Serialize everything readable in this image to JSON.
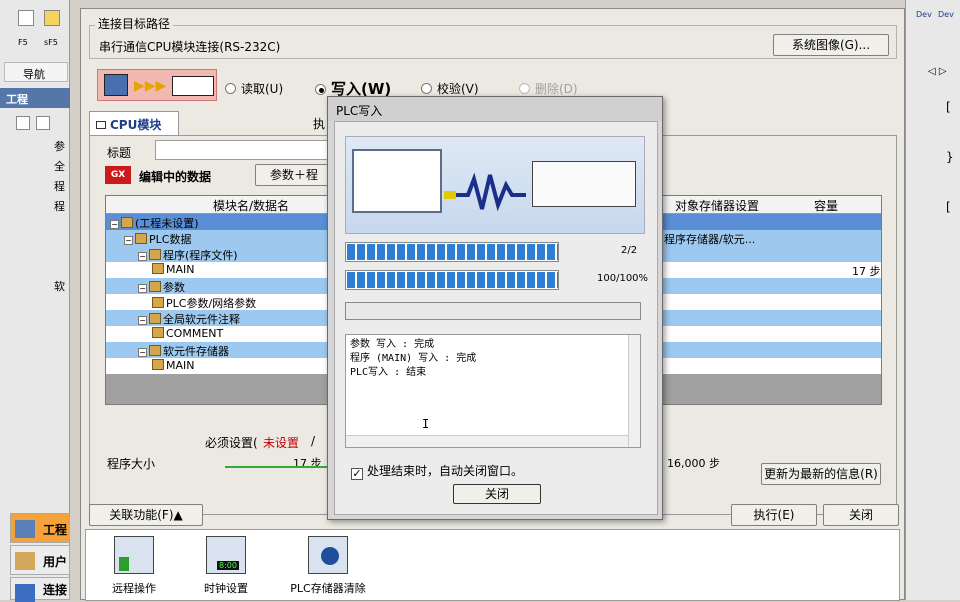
{
  "left_panel": {
    "toolbar_labels": [
      "F5",
      "sF5"
    ],
    "nav_title": "导航",
    "section_title": "工程",
    "tree_partial": [
      "参",
      "全",
      "程",
      "程",
      "软"
    ],
    "bottom_nav": [
      {
        "label": "工程",
        "active": true
      },
      {
        "label": "用户",
        "active": false
      },
      {
        "label": "连接",
        "active": false
      }
    ]
  },
  "right_panel": {
    "labels": [
      "Dev",
      "Dev"
    ]
  },
  "main": {
    "connection_group_title": "连接目标路径",
    "connection_value": "串行通信CPU模块连接(RS-232C)",
    "system_image_button": "系统图像(G)...",
    "radios": [
      {
        "label": "读取(U)",
        "selected": false,
        "disabled": false
      },
      {
        "label": "写入(W)",
        "selected": true,
        "disabled": false
      },
      {
        "label": "校验(V)",
        "selected": false,
        "disabled": false
      },
      {
        "label": "删除(D)",
        "selected": false,
        "disabled": true
      }
    ],
    "tab_label": "CPU模块",
    "tab_partial": "执",
    "title_label": "标题",
    "editing_data_label": "编辑中的数据",
    "param_button": "参数＋程",
    "table": {
      "headers": [
        "模块名/数据名",
        "对象存储器设置",
        "容量"
      ],
      "rows": [
        {
          "name": "(工程未设置)",
          "indent": 0,
          "style": "sel",
          "target": "",
          "capacity": ""
        },
        {
          "name": "PLC数据",
          "indent": 1,
          "style": "hi",
          "target": "程序存储器/软元...",
          "capacity": ""
        },
        {
          "name": "程序(程序文件)",
          "indent": 2,
          "style": "hi",
          "target": "",
          "capacity": ""
        },
        {
          "name": "MAIN",
          "indent": 3,
          "style": "lo",
          "target": "",
          "capacity": "17 步"
        },
        {
          "name": "参数",
          "indent": 2,
          "style": "hi",
          "target": "",
          "capacity": ""
        },
        {
          "name": "PLC参数/网络参数",
          "indent": 3,
          "style": "lo",
          "target": "",
          "capacity": ""
        },
        {
          "name": "全局软元件注释",
          "indent": 2,
          "style": "hi",
          "target": "",
          "capacity": ""
        },
        {
          "name": "COMMENT",
          "indent": 3,
          "style": "lo",
          "target": "",
          "capacity": ""
        },
        {
          "name": "软元件存储器",
          "indent": 2,
          "style": "hi",
          "target": "",
          "capacity": ""
        },
        {
          "name": "MAIN",
          "indent": 3,
          "style": "lo",
          "target": "",
          "capacity": ""
        }
      ]
    },
    "required_setting_label": "必须设置(",
    "required_setting_value": "未设置",
    "required_setting_sep": "/",
    "program_size_label": "程序大小",
    "program_size_value": "17 步",
    "program_capacity_value": "16,000 步",
    "refresh_button": "更新为最新的信息(R)",
    "related_func_button": "关联功能(F)▲",
    "execute_button": "执行(E)",
    "close_button": "关闭",
    "tools": [
      {
        "label": "远程操作",
        "icon": "remote-operation-icon"
      },
      {
        "label": "时钟设置",
        "icon": "clock-setting-icon",
        "badge": "8:00"
      },
      {
        "label": "PLC存储器清除",
        "icon": "plc-memory-clear-icon"
      }
    ]
  },
  "plc_write_dialog": {
    "title": "PLC写入",
    "progress1": {
      "text": "2/2",
      "fraction": 1.0
    },
    "progress2": {
      "text": "100/100%",
      "fraction": 1.0
    },
    "progress3": {
      "fraction": 0.0
    },
    "log_lines": [
      "参数 写入 : 完成",
      "程序 (MAIN) 写入 : 完成",
      "PLC写入 : 结束"
    ],
    "auto_close_label": "处理结束时，自动关闭窗口。",
    "auto_close_checked": true,
    "close_button": "关闭"
  },
  "colors": {
    "row_highlight": "#9dc9f0",
    "row_selected": "#5a8fd6",
    "progress_fill": "#2d7fd6",
    "required_value": "#c00000",
    "size_bar": "#33aa33"
  }
}
